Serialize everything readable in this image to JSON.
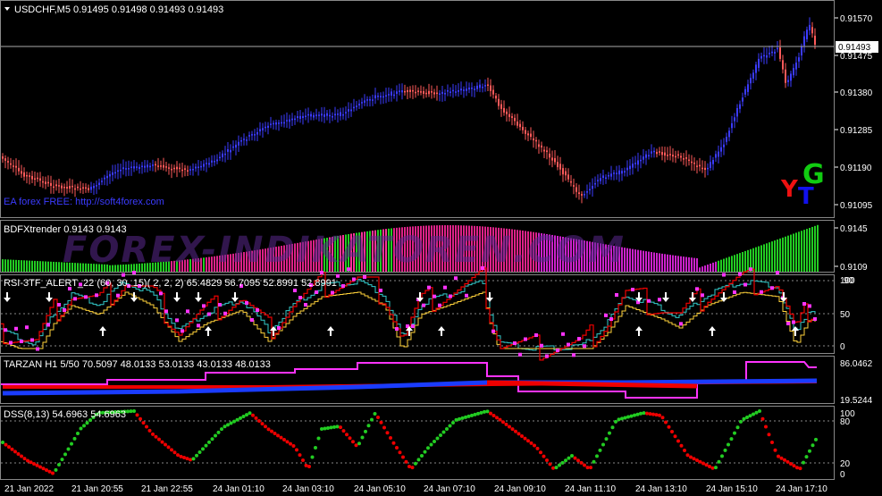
{
  "main": {
    "header": "USDCHF,M5  0.91495 0.91498 0.91493 0.91493",
    "current_price": "0.91493",
    "axis_labels": [
      "0.91570",
      "0.91475",
      "0.91380",
      "0.91285",
      "0.91190",
      "0.91095"
    ],
    "ea_text": "EA forex FREE: http://soft4forex.com",
    "logo_letters": [
      "Y",
      "T",
      "G"
    ]
  },
  "bdfx": {
    "header": "BDFXtrender 0.9143 0.9143",
    "watermark": "FOREX-INDIKATOREN.COM",
    "axis_labels": [
      "0.9145",
      "0.9109"
    ]
  },
  "rsi": {
    "header": "RSI-3TF_ALERT_22  (60, 30, 15)( 2, 2, 2)   65.4829 56.7095 52.8991 52.8991",
    "axis_labels": [
      "100",
      "90",
      "50",
      "0"
    ]
  },
  "tarzan": {
    "header": "TARZAN H1 5/50 70.5097 48.0133 53.0133 43.0133 48.0133",
    "axis_labels": [
      "86.0462",
      "19.5244"
    ]
  },
  "dss": {
    "header": "DSS(8,13) 54.6963 54.6963",
    "axis_labels": [
      "100",
      "80",
      "20",
      "0"
    ]
  },
  "time_axis": [
    "21 Jan 2022",
    "21 Jan 20:55",
    "21 Jan 22:55",
    "24 Jan 01:10",
    "24 Jan 03:10",
    "24 Jan 05:10",
    "24 Jan 07:10",
    "24 Jan 09:10",
    "24 Jan 11:10",
    "24 Jan 13:10",
    "24 Jan 15:10",
    "24 Jan 17:10"
  ],
  "colors": {
    "bull": "#3b3bff",
    "bear": "#ff5a5a",
    "grid": "#ffffff",
    "magenta": "#ff33ff",
    "green": "#22cc22",
    "red": "#ee0000"
  }
}
